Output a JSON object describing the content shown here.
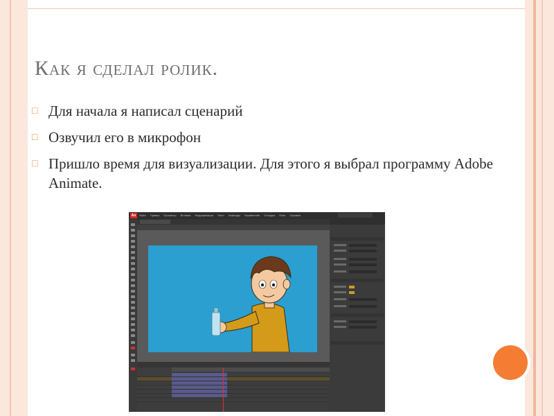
{
  "slide": {
    "title": "Как я сделал ролик.",
    "bullets": [
      {
        "text": "Для начала я написал сценарий"
      },
      {
        "text": "Озвучил его в микрофон"
      },
      {
        "text": "Пришло время для визуализации. Для этого я выбрал программу Adobe Animate."
      }
    ],
    "bullet_icon": "hollow-square-icon",
    "colors": {
      "frame": "#fbe7dc",
      "accent": "#f47d33",
      "title": "#6e6e6e",
      "text": "#2b2b2b"
    }
  },
  "screenshot": {
    "app_logo": "An",
    "menu": [
      "Файл",
      "Правка",
      "Просмотр",
      "Вставка",
      "Модификация",
      "Текст",
      "Команды",
      "Управление",
      "Отладка",
      "Окно",
      "Справка"
    ],
    "stage_colors": {
      "background": "#2a9fd0",
      "hair": "#6b3a1e",
      "sweater": "#d49a1a",
      "skin": "#f5c9a0",
      "bottle": "#bfe3f0"
    }
  }
}
